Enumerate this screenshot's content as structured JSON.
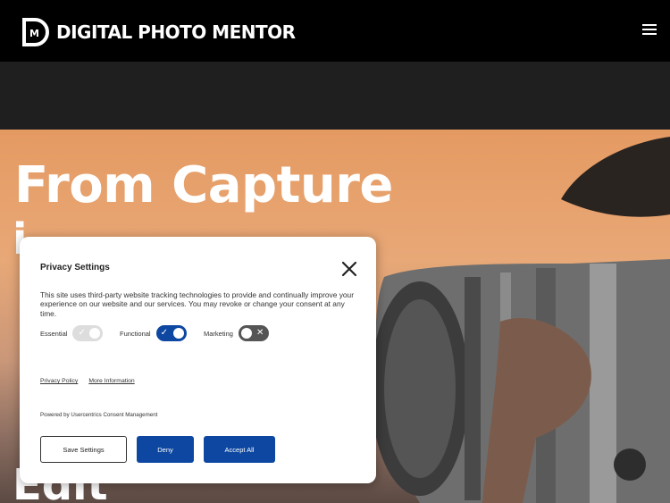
{
  "header": {
    "logo_text": "DIGITAL PHOTO MENTOR",
    "logo_icon": "dm-logo-icon",
    "menu_icon": "hamburger-menu-icon"
  },
  "hero": {
    "title": "From Capture",
    "frag_i": "i",
    "frag_e": "Edit"
  },
  "privacy": {
    "title": "Privacy Settings",
    "description": "This site uses third-party website tracking technologies to provide and continually improve your experience on our website and our services. You may revoke or change your consent at any time.",
    "toggles": {
      "essential": {
        "label": "Essential",
        "state": "on-disabled"
      },
      "functional": {
        "label": "Functional",
        "state": "on"
      },
      "marketing": {
        "label": "Marketing",
        "state": "off"
      }
    },
    "links": {
      "privacy_policy": "Privacy Policy",
      "more_information": "More Information"
    },
    "powered_by": "Powered by Usercentrics Consent Management",
    "buttons": {
      "save": "Save Settings",
      "deny": "Deny",
      "accept": "Accept All"
    },
    "colors": {
      "accent": "#0d47a1",
      "toggle_off": "#555555",
      "toggle_disabled": "#dddddd"
    }
  }
}
